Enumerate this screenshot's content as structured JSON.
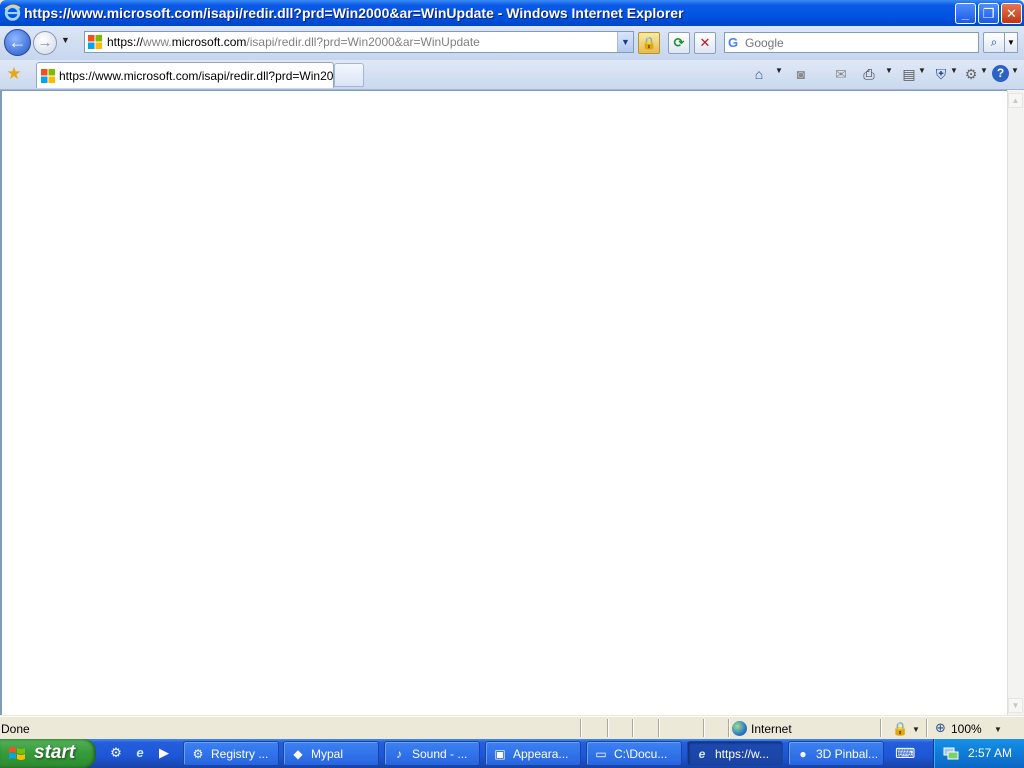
{
  "window": {
    "title": "https://www.microsoft.com/isapi/redir.dll?prd=Win2000&ar=WinUpdate - Windows Internet Explorer",
    "minimize_glyph": "_",
    "restore_glyph": "❐",
    "close_glyph": "✕"
  },
  "navbar": {
    "back_glyph": "←",
    "forward_glyph": "→",
    "dropdown_glyph": "▼",
    "address_scheme": "https://",
    "address_prefix": "www.",
    "address_domain": "microsoft.com",
    "address_path": "/isapi/redir.dll?prd=Win2000&ar=WinUpdate",
    "lock_glyph": "🔒",
    "refresh_glyph": "⟳",
    "stop_glyph": "✕",
    "search_logo": "G",
    "search_placeholder": "Google",
    "search_glyph": "⌕",
    "search_drop_glyph": "▼"
  },
  "tabs": {
    "favorites_glyph": "★",
    "active_tab_label": "https://www.microsoft.com/isapi/redir.dll?prd=Win20...",
    "commands": [
      {
        "name": "home-icon",
        "glyph": "⌂"
      },
      {
        "name": "feeds-icon",
        "glyph": "◙"
      },
      {
        "name": "mail-icon",
        "glyph": "✉"
      },
      {
        "name": "print-icon",
        "glyph": "⎙"
      },
      {
        "name": "page-icon",
        "glyph": "▤"
      },
      {
        "name": "safety-icon",
        "glyph": "⛨"
      },
      {
        "name": "tools-icon",
        "glyph": "⚙"
      },
      {
        "name": "help-icon",
        "glyph": "?"
      }
    ]
  },
  "status": {
    "text": "Done",
    "zone": "Internet",
    "protected_glyph": "🔒",
    "zoom_glyph": "⊕",
    "zoom": "100%"
  },
  "taskbar": {
    "start_label": "start",
    "quick_launch": [
      {
        "name": "windows-update-icon",
        "glyph": "⚙"
      },
      {
        "name": "ie-quicklaunch-icon",
        "glyph": "e"
      },
      {
        "name": "media-player-icon",
        "glyph": "▶"
      }
    ],
    "tasks": [
      {
        "label": "Registry ...",
        "glyph": "⚙",
        "active": false
      },
      {
        "label": "Mypal",
        "glyph": "◆",
        "active": false
      },
      {
        "label": "Sound - ...",
        "glyph": "♪",
        "active": false
      },
      {
        "label": "Appeara...",
        "glyph": "▣",
        "active": false
      },
      {
        "label": "C:\\Docu...",
        "glyph": "▭",
        "active": false
      },
      {
        "label": "https://w...",
        "glyph": "e",
        "active": true
      },
      {
        "label": "3D Pinbal...",
        "glyph": "●",
        "active": false
      }
    ],
    "keyboard_glyph": "⌨",
    "clock": "2:57 AM"
  }
}
